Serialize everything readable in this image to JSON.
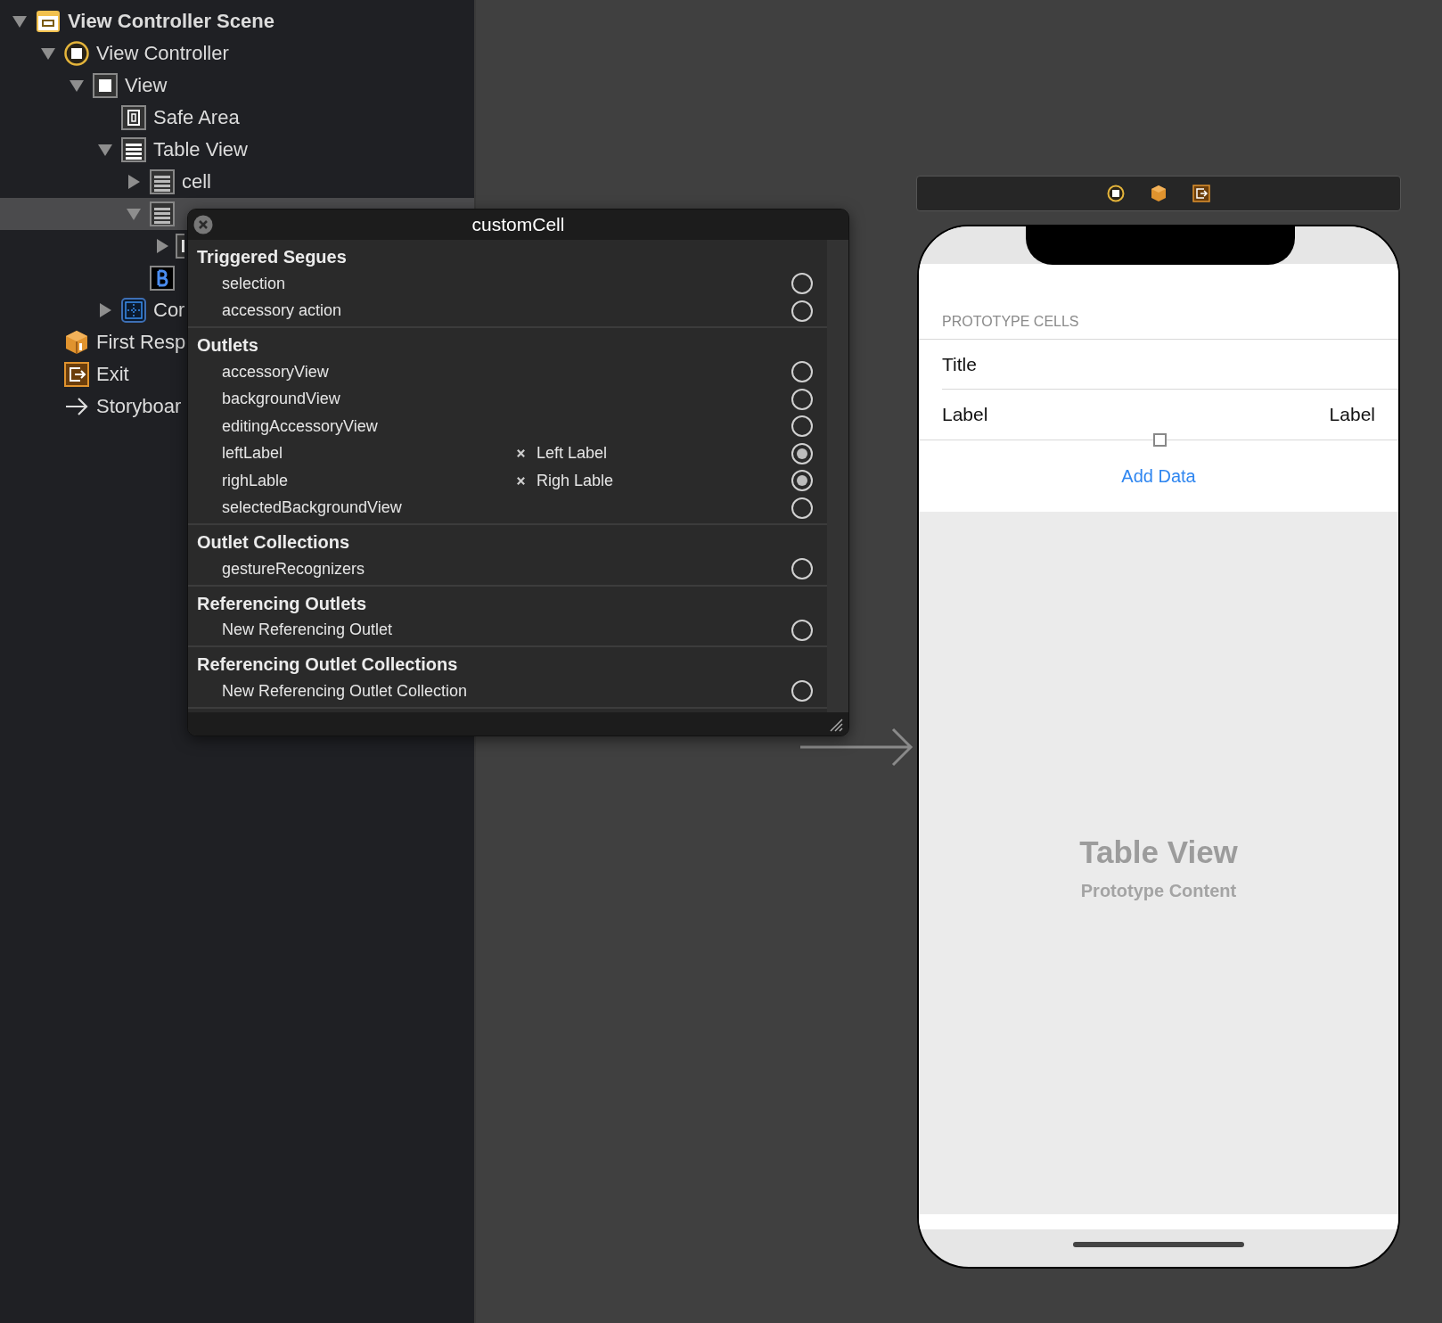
{
  "outline": {
    "items": [
      {
        "label": "View Controller Scene",
        "kind": "scene",
        "expanded": true,
        "selected": false,
        "children": [
          {
            "label": "View Controller",
            "kind": "controller",
            "expanded": true,
            "selected": false,
            "children": [
              {
                "label": "View",
                "kind": "view",
                "expanded": true,
                "selected": false,
                "children": [
                  {
                    "label": "Safe Area",
                    "kind": "safe-area",
                    "selected": false
                  },
                  {
                    "label": "Table View",
                    "kind": "table",
                    "expanded": true,
                    "selected": false,
                    "children": [
                      {
                        "label": "cell",
                        "kind": "cell",
                        "expanded": false,
                        "selected": false
                      },
                      {
                        "kind": "cell",
                        "expanded": true,
                        "selected": true,
                        "children": [
                          {
                            "kind": "generic",
                            "expanded": false,
                            "selected": false
                          }
                        ]
                      },
                      {
                        "kind": "button",
                        "selected": false
                      }
                    ]
                  },
                  {
                    "label": "Cor",
                    "kind": "constraints",
                    "expanded": false,
                    "selected": false
                  }
                ]
              }
            ]
          },
          {
            "label": "First Resp",
            "kind": "first-responder",
            "selected": false
          },
          {
            "label": "Exit",
            "kind": "exit",
            "selected": false
          },
          {
            "label": "Storyboar",
            "kind": "entry",
            "selected": false
          }
        ]
      }
    ]
  },
  "connections_popup": {
    "title": "customCell",
    "sections": [
      {
        "heading": "Triggered Segues",
        "items": [
          {
            "label": "selection",
            "connected": false
          },
          {
            "label": "accessory action",
            "connected": false
          }
        ]
      },
      {
        "heading": "Outlets",
        "items": [
          {
            "label": "accessoryView",
            "connected": false
          },
          {
            "label": "backgroundView",
            "connected": false
          },
          {
            "label": "editingAccessoryView",
            "connected": false
          },
          {
            "label": "leftLabel",
            "target": "Left Label",
            "connected": true
          },
          {
            "label": "righLable",
            "target": "Righ Lable",
            "connected": true
          },
          {
            "label": "selectedBackgroundView",
            "connected": false
          }
        ]
      },
      {
        "heading": "Outlet Collections",
        "items": [
          {
            "label": "gestureRecognizers",
            "connected": false
          }
        ]
      },
      {
        "heading": "Referencing Outlets",
        "items": [
          {
            "label": "New Referencing Outlet",
            "connected": false
          }
        ]
      },
      {
        "heading": "Referencing Outlet Collections",
        "items": [
          {
            "label": "New Referencing Outlet Collection",
            "connected": false
          }
        ]
      }
    ]
  },
  "device": {
    "section_header": "PROTOTYPE CELLS",
    "cells": [
      {
        "kind": "title",
        "left": "Title",
        "selected": false
      },
      {
        "kind": "detail",
        "left": "Label",
        "right": "Label",
        "selected": true
      }
    ],
    "button": "Add Data",
    "empty_title": "Table View",
    "empty_subtitle": "Prototype Content"
  }
}
